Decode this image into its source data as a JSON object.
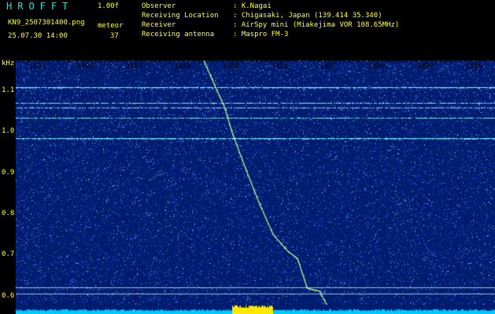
{
  "header": {
    "app_title": "HROFFT",
    "version": "1.00f",
    "filename": "KN9_2507301400.png",
    "mode": "meteor",
    "datetime": "25.07.30 14:00",
    "count": "37"
  },
  "meta": [
    {
      "key": "Observer",
      "value": ": K.Nagai"
    },
    {
      "key": "Receiving Location",
      "value": ": Chigasaki, Japan (139.414 35.340)"
    },
    {
      "key": "Receiver",
      "value": ": AirSpy mini (Miakejima VOR 108.65MHz)"
    },
    {
      "key": "Receiving antenna",
      "value": ": Maspro FM-3"
    }
  ],
  "colors": {
    "background": "#001c6e",
    "noise": "#2a6cff",
    "signal": "#5fe8f5",
    "meteor_trace": "#9cf08a",
    "labels": "#ffff33",
    "title": "#12e8e8",
    "bottom_strip": "#00c8ff",
    "bottom_burst": "#ffe800"
  },
  "chart_data": {
    "type": "heatmap",
    "y_unit": "kHz",
    "y_ticks": [
      "1.1",
      "1.0",
      "0.9",
      "0.8",
      "0.7",
      "0.6"
    ],
    "x_ticks": [
      "1401",
      "1402",
      "1403",
      "1404",
      "1405",
      "1406",
      "1407",
      "1408",
      "1409",
      "1410"
    ],
    "ylim": [
      0.58,
      1.175
    ],
    "xlim": [
      1400.54,
      1410.42
    ],
    "horizontal_signals": [
      {
        "freq": 1.109,
        "strength": 0.95
      },
      {
        "freq": 1.072,
        "strength": 0.55
      },
      {
        "freq": 1.06,
        "strength": 0.5
      },
      {
        "freq": 1.035,
        "strength": 0.55
      },
      {
        "freq": 0.985,
        "strength": 0.9
      }
    ],
    "meteor_trace": [
      {
        "t": 1404.42,
        "f": 1.175
      },
      {
        "t": 1404.62,
        "f": 1.12
      },
      {
        "t": 1404.85,
        "f": 1.06
      },
      {
        "t": 1405.0,
        "f": 1.0
      },
      {
        "t": 1405.25,
        "f": 0.92
      },
      {
        "t": 1405.55,
        "f": 0.83
      },
      {
        "t": 1405.85,
        "f": 0.75
      },
      {
        "t": 1406.15,
        "f": 0.71
      },
      {
        "t": 1406.35,
        "f": 0.692
      },
      {
        "t": 1406.55,
        "f": 0.62
      },
      {
        "t": 1406.8,
        "f": 0.613
      },
      {
        "t": 1406.95,
        "f": 0.58
      }
    ],
    "reference_lines": [
      0.622,
      0.607
    ],
    "burst_range": [
      1405.0,
      1405.85
    ]
  }
}
